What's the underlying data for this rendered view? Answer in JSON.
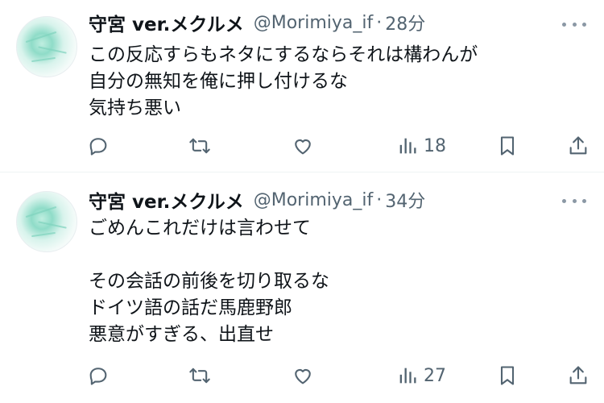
{
  "tweets": [
    {
      "author": "守宮 ver.メクルメ",
      "handle": "@Morimiya_if",
      "separator": "·",
      "time": "28分",
      "lines": [
        "この反応すらもネタにするならそれは構わんが",
        "自分の無知を俺に押し付けるな",
        "気持ち悪い"
      ],
      "views": "18"
    },
    {
      "author": "守宮 ver.メクルメ",
      "handle": "@Morimiya_if",
      "separator": "·",
      "time": "34分",
      "lines": [
        "ごめんこれだけは言わせて",
        "",
        "その会話の前後を切り取るな",
        "ドイツ語の話だ馬鹿野郎",
        "悪意がすぎる、出直せ"
      ],
      "views": "27"
    }
  ],
  "icons": {
    "reply": "reply-icon",
    "retweet": "retweet-icon",
    "like": "like-icon",
    "views": "views-icon",
    "bookmark": "bookmark-icon",
    "share": "share-icon",
    "more": "more-icon"
  },
  "colors": {
    "text": "#0f1419",
    "secondary": "#536471",
    "divider": "#eff3f4",
    "avatar_accent": "#8fdcc8"
  }
}
